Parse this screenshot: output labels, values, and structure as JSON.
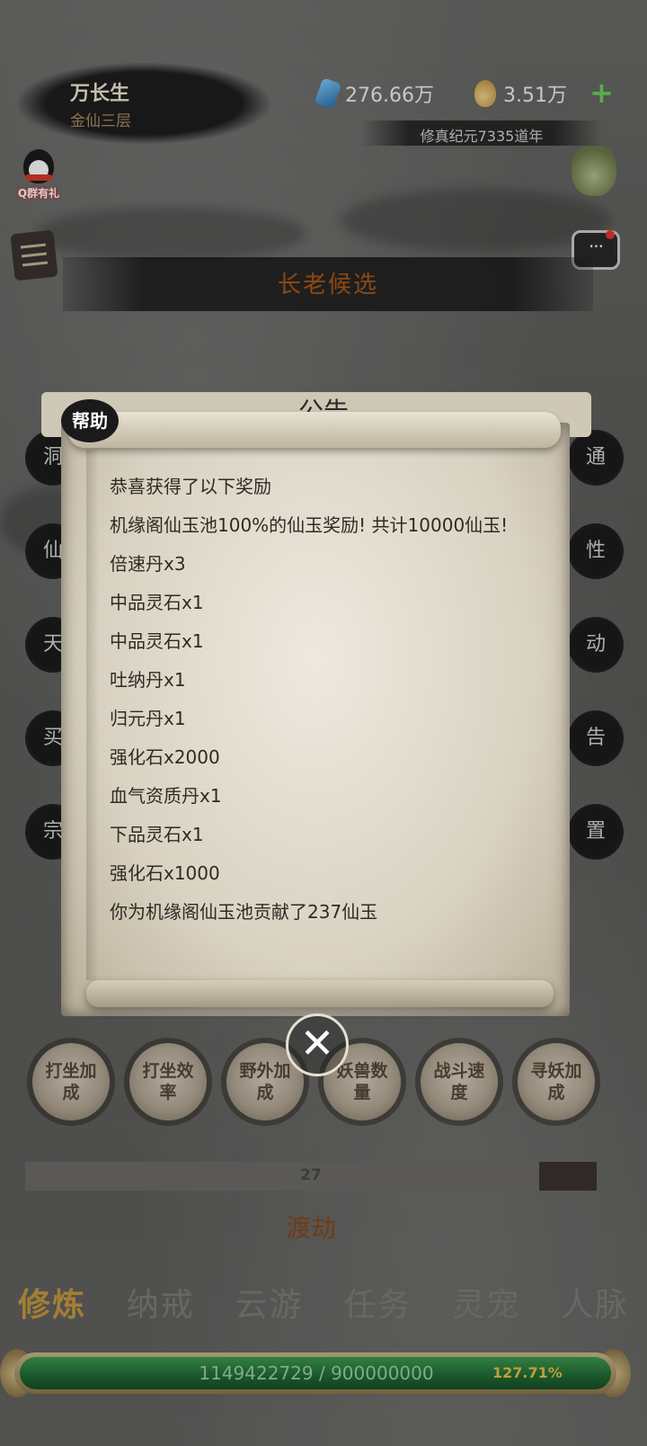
{
  "header": {
    "player_name": "万长生",
    "player_rank": "金仙三层",
    "jade_amount": "276.66万",
    "gold_amount": "3.51万",
    "add_label": "+",
    "era": "修真纪元7335道年",
    "qq_group_label": "Q群有礼"
  },
  "elder_banner": "长老候选",
  "side_buttons_left": [
    "洞",
    "仙",
    "天",
    "买",
    "宗"
  ],
  "side_buttons_right": [
    "通",
    "性",
    "动",
    "告",
    "置"
  ],
  "popup": {
    "badge": "帮助",
    "hidden_title": "公告",
    "lines": [
      "恭喜获得了以下奖励",
      "机缘阁仙玉池100%的仙玉奖励! 共计10000仙玉!",
      "倍速丹x3",
      "中品灵石x1",
      "中品灵石x1",
      "吐纳丹x1",
      "归元丹x1",
      "强化石x2000",
      "血气资质丹x1",
      "下品灵石x1",
      "强化石x1000",
      "你为机缘阁仙玉池贡献了237仙玉"
    ],
    "close_icon": "✕"
  },
  "boost_buttons": [
    "打坐加成",
    "打坐效率",
    "野外加成",
    "妖兽数量",
    "战斗速度",
    "寻妖加成"
  ],
  "progress": {
    "label": "27",
    "fill_fraction": 0.1
  },
  "dujie_label": "渡劫",
  "tabs": [
    "修炼",
    "纳戒",
    "云游",
    "任务",
    "灵宠",
    "人脉"
  ],
  "active_tab": "修炼",
  "exp": {
    "text": "1149422729 / 900000000",
    "percent": "127.71%"
  },
  "colors": {
    "accent_gold": "#c79a40",
    "exp_green": "#1f6b34",
    "elder_text": "#a95a1a"
  }
}
